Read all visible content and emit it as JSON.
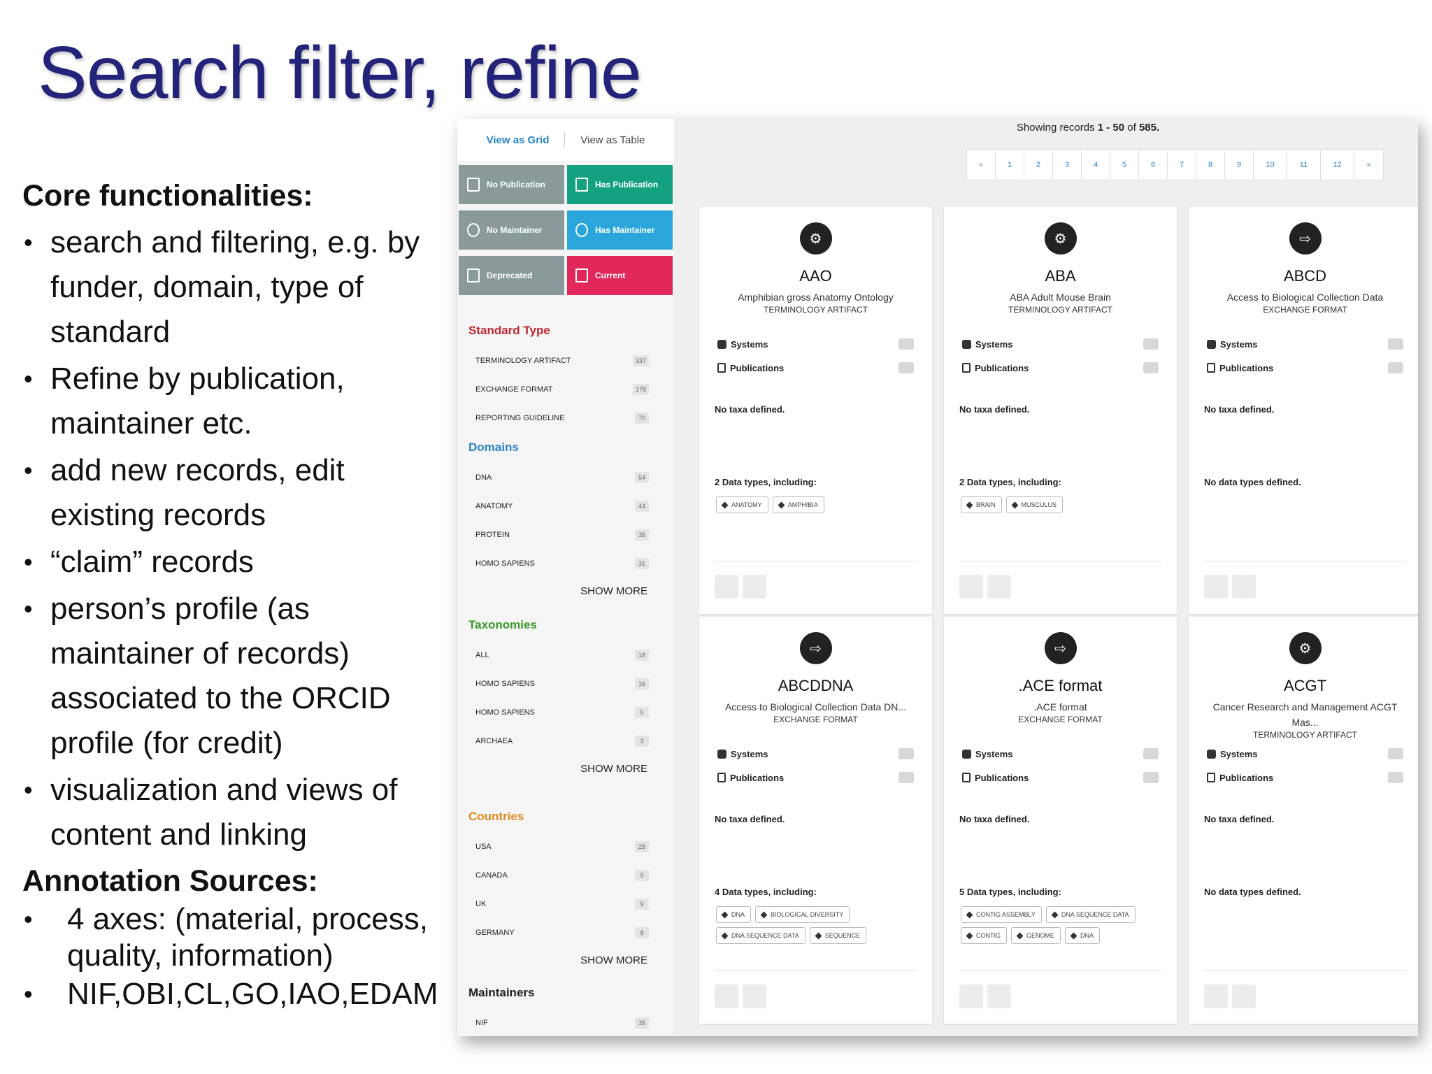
{
  "slide": {
    "title": "Search filter, refine",
    "core_heading": "Core functionalities:",
    "core_items": [
      "search and filtering, e.g. by funder, domain, type of standard",
      "Refine by publication, maintainer etc.",
      "add new records, edit existing records",
      "“claim” records",
      "person’s profile (as maintainer of records) associated to the ORCID profile (for credit)",
      "visualization and views of content and linking"
    ],
    "annotation_heading": "Annotation Sources:",
    "annotation_items": [
      "4 axes: (material, process, quality, information)",
      "NIF,OBI,CL,GO,IAO,EDAM"
    ]
  },
  "view_toggle": {
    "grid": "View as Grid",
    "table": "View as Table"
  },
  "filter_buttons": {
    "no_publication": "No Publication",
    "has_publication": "Has Publication",
    "no_maintainer": "No Maintainer",
    "has_maintainer": "Has Maintainer",
    "deprecated": "Deprecated",
    "current": "Current"
  },
  "facets": {
    "standard_type": {
      "title": "Standard Type",
      "color": "#c0272d",
      "items": [
        {
          "label": "TERMINOLOGY ARTIFACT",
          "count": "337"
        },
        {
          "label": "EXCHANGE FORMAT",
          "count": "178"
        },
        {
          "label": "REPORTING GUIDELINE",
          "count": "70"
        }
      ]
    },
    "domains": {
      "title": "Domains",
      "color": "#2a83c9",
      "items": [
        {
          "label": "DNA",
          "count": "54"
        },
        {
          "label": "ANATOMY",
          "count": "44"
        },
        {
          "label": "PROTEIN",
          "count": "35"
        },
        {
          "label": "HOMO SAPIENS",
          "count": "31"
        }
      ],
      "show_more": "SHOW MORE"
    },
    "taxonomies": {
      "title": "Taxonomies",
      "color": "#3c9a2b",
      "items": [
        {
          "label": "ALL",
          "count": "18"
        },
        {
          "label": "HOMO SAPIENS",
          "count": "16"
        },
        {
          "label": "HOMO SAPIENS",
          "count": "5"
        },
        {
          "label": "ARCHAEA",
          "count": "3"
        }
      ],
      "show_more": "SHOW MORE"
    },
    "countries": {
      "title": "Countries",
      "color": "#e08a1e",
      "items": [
        {
          "label": "USA",
          "count": "28"
        },
        {
          "label": "CANADA",
          "count": "9"
        },
        {
          "label": "UK",
          "count": "9"
        },
        {
          "label": "GERMANY",
          "count": "8"
        }
      ],
      "show_more": "SHOW MORE"
    },
    "maintainers": {
      "title": "Maintainers",
      "color": "#222222",
      "items": [
        {
          "label": "NIF",
          "count": "35"
        }
      ]
    }
  },
  "results": {
    "showing_prefix": "Showing records ",
    "showing_range": "1 - 50",
    "showing_of": " of ",
    "showing_total": "585.",
    "pages": [
      "«",
      "1",
      "2",
      "3",
      "4",
      "5",
      "6",
      "7",
      "8",
      "9",
      "10",
      "11",
      "12",
      "»"
    ]
  },
  "cards": [
    {
      "abbr": "AAO",
      "name": "Amphibian gross Anatomy Ontology",
      "type": "TERMINOLOGY ARTIFACT",
      "systems": "Systems",
      "publications": "Publications",
      "taxa": "No taxa defined.",
      "datatypes": "2 Data types, including:",
      "tags": [
        "ANATOMY",
        "AMPHIBIA"
      ]
    },
    {
      "abbr": "ABA",
      "name": "ABA Adult Mouse Brain",
      "type": "TERMINOLOGY ARTIFACT",
      "systems": "Systems",
      "publications": "Publications",
      "taxa": "No taxa defined.",
      "datatypes": "2 Data types, including:",
      "tags": [
        "BRAIN",
        "MUSCULUS"
      ]
    },
    {
      "abbr": "ABCD",
      "name": "Access to Biological Collection Data",
      "type": "EXCHANGE FORMAT",
      "systems": "Systems",
      "publications": "Publications",
      "taxa": "No taxa defined.",
      "datatypes": "No data types defined.",
      "tags": []
    },
    {
      "abbr": "ABCDDNA",
      "name": "Access to Biological Collection Data DN...",
      "type": "EXCHANGE FORMAT",
      "systems": "Systems",
      "publications": "Publications",
      "taxa": "No taxa defined.",
      "datatypes": "4 Data types, including:",
      "tags": [
        "DNA",
        "BIOLOGICAL DIVERSITY",
        "DNA SEQUENCE DATA",
        "SEQUENCE"
      ]
    },
    {
      "abbr": ".ACE format",
      "name": ".ACE format",
      "type": "EXCHANGE FORMAT",
      "systems": "Systems",
      "publications": "Publications",
      "taxa": "No taxa defined.",
      "datatypes": "5 Data types, including:",
      "tags": [
        "CONTIG ASSEMBLY",
        "DNA SEQUENCE DATA",
        "CONTIG",
        "GENOME",
        "DNA"
      ]
    },
    {
      "abbr": "ACGT",
      "name": "Cancer Research and Management ACGT Mas...",
      "type": "TERMINOLOGY ARTIFACT",
      "systems": "Systems",
      "publications": "Publications",
      "taxa": "No taxa defined.",
      "datatypes": "No data types defined.",
      "tags": []
    }
  ]
}
